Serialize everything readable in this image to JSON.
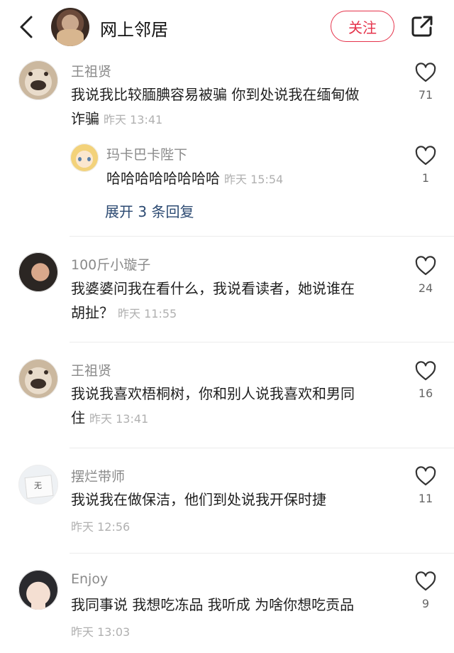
{
  "header": {
    "back_icon": "chevron-left-icon",
    "title": "网上邻居",
    "follow_label": "关注",
    "share_icon": "share-out-icon",
    "accent_color": "#e5334b"
  },
  "comments": [
    {
      "name": "王祖贤",
      "line1": "我说我比较腼腆容易被骗 你到处说我在缅甸做",
      "line2": "诈骗",
      "time": "昨天 13:41",
      "likes": "71",
      "reply": {
        "name": "玛卡巴卡陛下",
        "text": "哈哈哈哈哈哈哈哈",
        "time": "昨天 15:54",
        "likes": "1"
      },
      "expand_label": "展开 3 条回复"
    },
    {
      "name": "100斤小璇子",
      "line1": "我婆婆问我在看什么，我说看读者，她说谁在",
      "line2": "胡扯？",
      "time": "昨天 11:55",
      "likes": "24"
    },
    {
      "name": "王祖贤",
      "line1": "我说我喜欢梧桐树，你和别人说我喜欢和男同",
      "line2": "住",
      "time": "昨天 13:41",
      "likes": "16"
    },
    {
      "name": "摆烂带师",
      "line1": "我说我在做保洁，他们到处说我开保时捷",
      "time": "昨天 12:56",
      "likes": "11",
      "avatar_text": "无"
    },
    {
      "name": "Enjoy",
      "line1": "我同事说 我想吃冻品 我听成 为啥你想吃贡品",
      "time": "昨天 13:03",
      "likes": "9"
    }
  ]
}
